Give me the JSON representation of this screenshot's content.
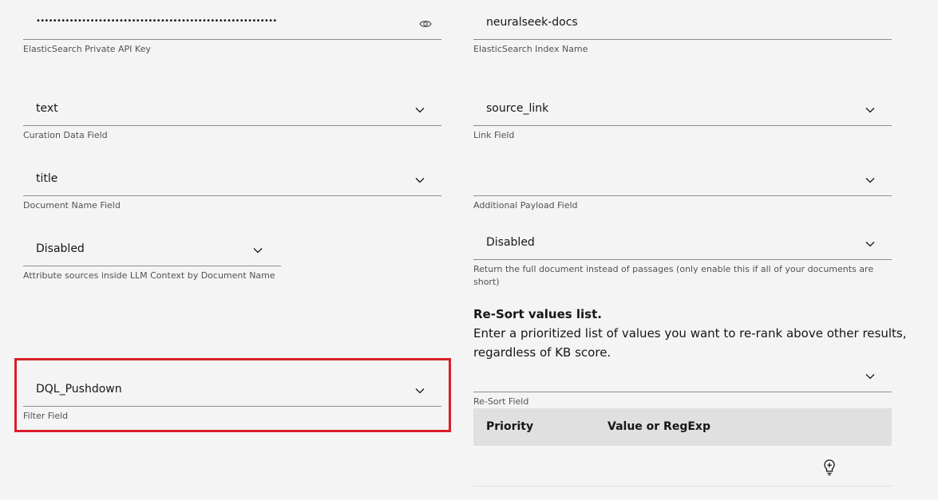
{
  "left": {
    "api_key": {
      "value": "••••••••••••••••••••••••••••••••••••••••••••••••••••••••••",
      "label": "ElasticSearch Private API Key"
    },
    "curation_data": {
      "value": "text",
      "label": "Curation Data Field"
    },
    "document_name": {
      "value": "title",
      "label": "Document Name Field"
    },
    "attribute_sources": {
      "value": "Disabled",
      "label": "Attribute sources inside LLM Context by Document Name"
    },
    "filter": {
      "value": "DQL_Pushdown",
      "label": "Filter Field"
    }
  },
  "right": {
    "index_name": {
      "value": "neuralseek-docs",
      "label": "ElasticSearch Index Name"
    },
    "link": {
      "value": "source_link",
      "label": "Link Field"
    },
    "additional_payload": {
      "value": "",
      "label": "Additional Payload Field"
    },
    "full_document": {
      "value": "Disabled",
      "label": "Return the full document instead of passages (only enable this if all of your documents are short)"
    },
    "resort": {
      "title": "Re-Sort values list.",
      "description": "Enter a prioritized list of values you want to re-rank above other results, regardless of KB score.",
      "field_value": "",
      "field_label": "Re-Sort Field",
      "columns": [
        "Priority",
        "Value or RegExp"
      ]
    }
  },
  "colors": {
    "highlight": "#da1e28",
    "background": "#f4f4f4",
    "table_header": "#e0e0e0"
  },
  "icons": {
    "password_toggle": "eye-icon",
    "dropdown": "chevron-down-icon",
    "suggest": "lightbulb-icon"
  }
}
